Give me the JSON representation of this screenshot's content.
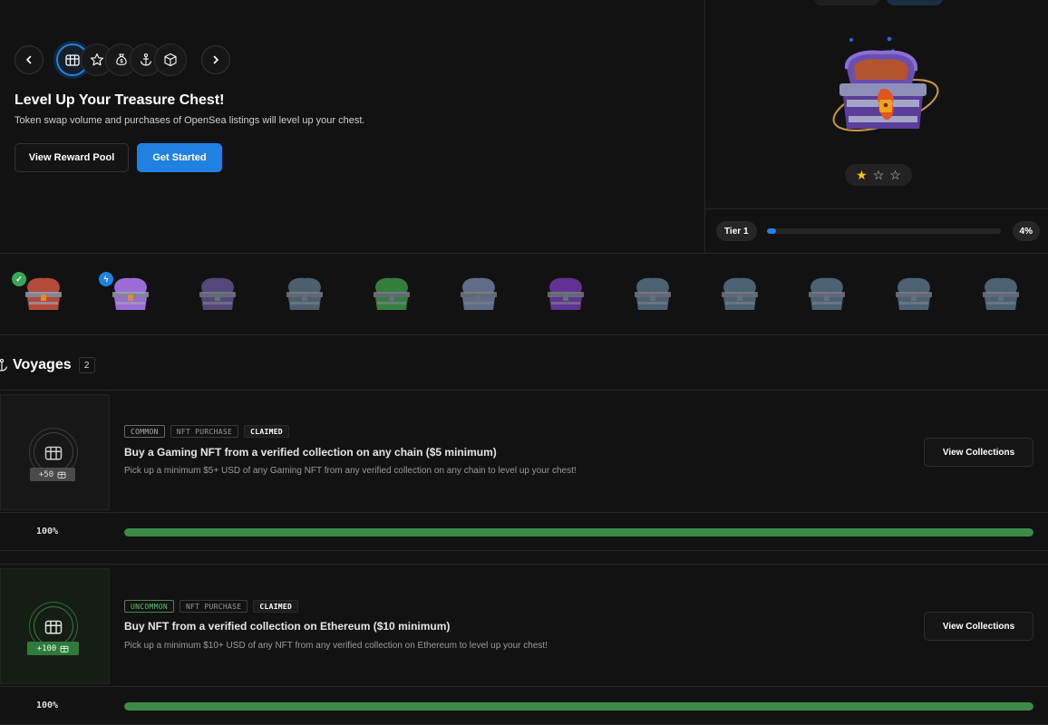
{
  "hero": {
    "nav": {
      "prev_icon": "chevron-left-icon",
      "next_icon": "chevron-right-icon",
      "categories": [
        {
          "icon": "treasure-chest-icon",
          "active": true
        },
        {
          "icon": "star-icon",
          "active": false
        },
        {
          "icon": "money-bag-icon",
          "active": false
        },
        {
          "icon": "anchor-icon",
          "active": false
        },
        {
          "icon": "cube-icon",
          "active": false
        }
      ]
    },
    "title": "Level Up Your Treasure Chest!",
    "subtitle": "Token swap volume and purchases of OpenSea listings will level up your chest.",
    "view_reward_pool_label": "View Reward Pool",
    "get_started_label": "Get Started"
  },
  "chest_panel": {
    "stars_filled": 1,
    "stars_total": 3,
    "tier_label": "Tier 1",
    "progress_percent": 4,
    "progress_label": "4%"
  },
  "chest_strip": [
    {
      "color": "#b34a3a",
      "status": "completed"
    },
    {
      "color": "#9b6bd6",
      "status": "current"
    },
    {
      "color": "#6a5a9a",
      "status": "locked"
    },
    {
      "color": "#5e7a8a",
      "status": "locked"
    },
    {
      "color": "#3fa24a",
      "status": "locked"
    },
    {
      "color": "#7a8ab0",
      "status": "locked"
    },
    {
      "color": "#7a3fbf",
      "status": "locked"
    },
    {
      "color": "#5f7d92",
      "status": "locked"
    },
    {
      "color": "#5f7d92",
      "status": "locked"
    },
    {
      "color": "#5f7d92",
      "status": "locked"
    },
    {
      "color": "#5f7d92",
      "status": "locked"
    },
    {
      "color": "#5f7d92",
      "status": "locked"
    }
  ],
  "voyages": {
    "title": "Voyages",
    "count": "2",
    "items": [
      {
        "points": "+50",
        "rarity": "COMMON",
        "type": "NFT PURCHASE",
        "status": "CLAIMED",
        "title": "Buy a Gaming NFT from a verified collection on any chain ($5 minimum)",
        "description": "Pick up a minimum $5+ USD of any Gaming NFT from any verified collection on any chain to level up your chest!",
        "button": "View Collections",
        "progress_label": "100%",
        "progress_percent": 100
      },
      {
        "points": "+100",
        "rarity": "UNCOMMON",
        "type": "NFT PURCHASE",
        "status": "CLAIMED",
        "title": "Buy NFT from a verified collection on Ethereum ($10 minimum)",
        "description": "Pick up a minimum $10+ USD of any NFT from any verified collection on Ethereum to level up your chest!",
        "button": "View Collections",
        "progress_label": "100%",
        "progress_percent": 100
      }
    ]
  }
}
